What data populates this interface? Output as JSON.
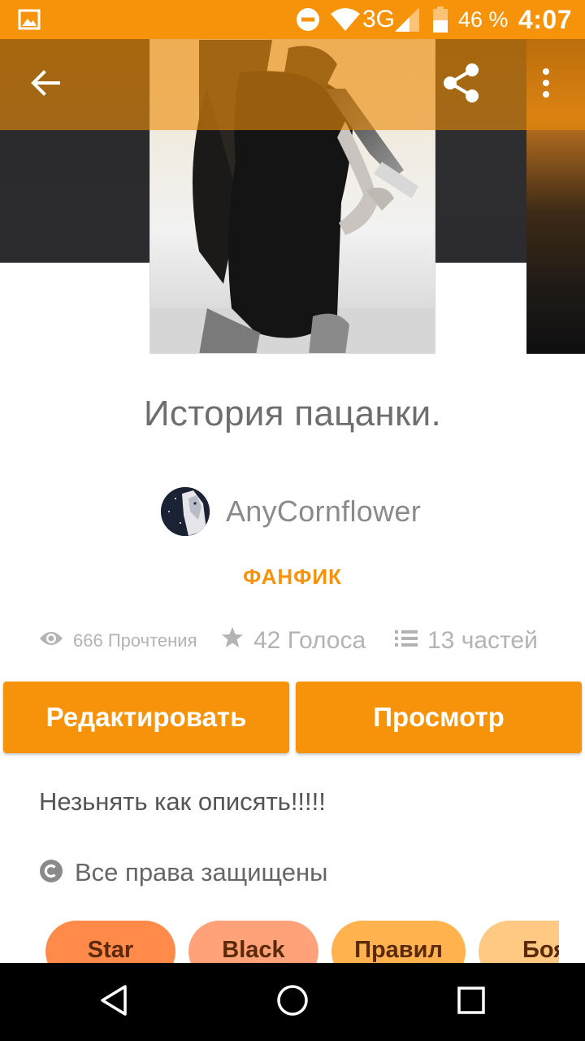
{
  "status_bar": {
    "network": "3G",
    "battery_percent": "46 %",
    "time": "4:07",
    "icons": [
      "image-notification-icon",
      "do-not-disturb-icon",
      "wifi-icon",
      "signal-icon",
      "battery-icon"
    ]
  },
  "toolbar": {
    "icons": [
      "back-arrow-icon",
      "share-icon",
      "more-vertical-icon"
    ]
  },
  "story": {
    "title": "История пацанки.",
    "author": "AnyCornflower",
    "category": "ФАНФИК",
    "stats": {
      "reads": "666 Прочтения",
      "votes": "42 Голоса",
      "parts": "13 частей"
    },
    "description": "Незьнять как описять!!!!!",
    "copyright": "Все права защищены"
  },
  "actions": {
    "edit_label": "Редактировать",
    "view_label": "Просмотр"
  },
  "tags": [
    "Star",
    "Black",
    "Правил",
    "Боя"
  ],
  "colors": {
    "accent": "#f7930a",
    "toolbar_overlay": "#eb8c0a",
    "tag_colors": [
      "#ff8a4a",
      "#ffa27a",
      "#ffb24d",
      "#ffc983"
    ],
    "text_gray": "#6e6e6e",
    "stat_gray": "#b3b3b3"
  },
  "nav_bar": {
    "icons": [
      "nav-back-icon",
      "nav-home-icon",
      "nav-recent-icon"
    ]
  }
}
